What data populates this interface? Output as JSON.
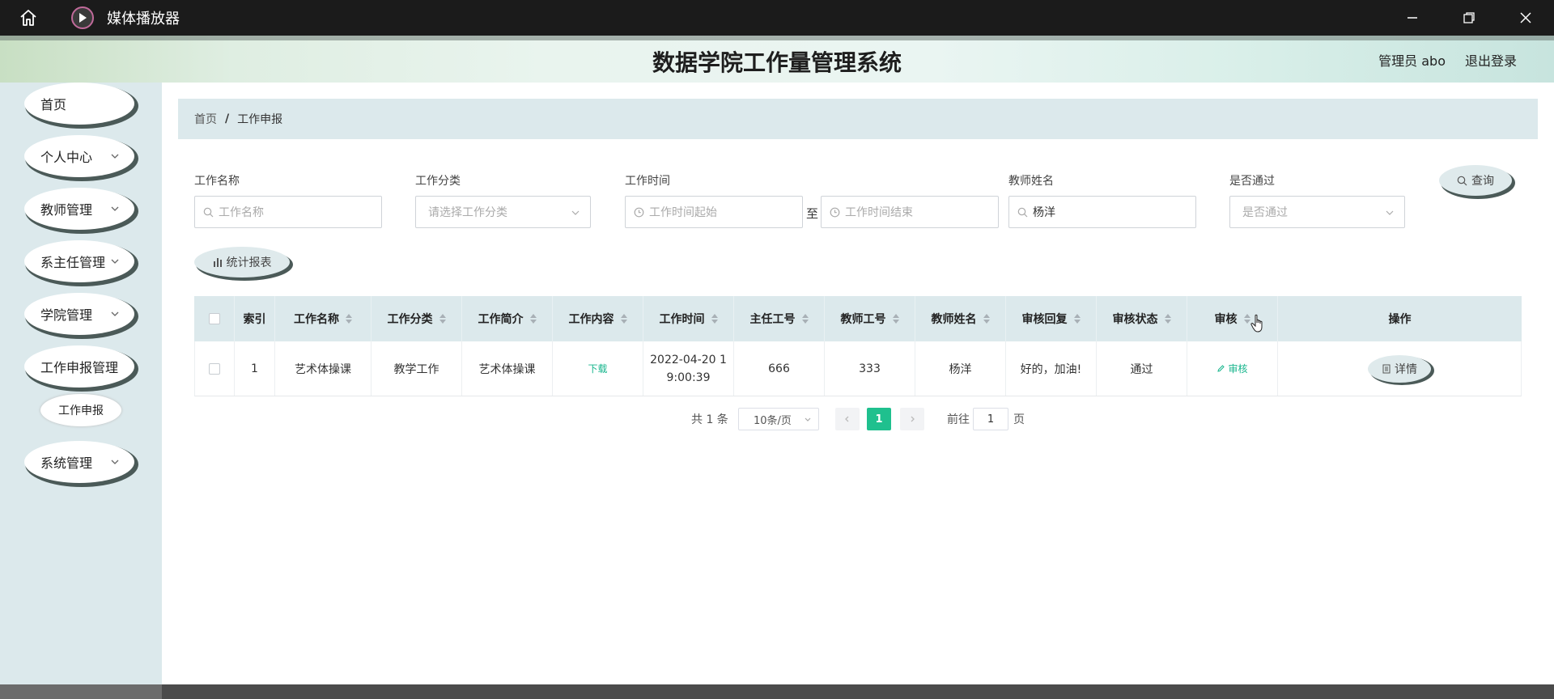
{
  "window": {
    "title": "媒体播放器"
  },
  "header": {
    "system_title": "数据学院工作量管理系统",
    "admin": "管理员 abo",
    "logout": "退出登录"
  },
  "sidebar": {
    "items": [
      {
        "label": "首页"
      },
      {
        "label": "个人中心"
      },
      {
        "label": "教师管理"
      },
      {
        "label": "系主任管理"
      },
      {
        "label": "学院管理"
      },
      {
        "label": "工作申报管理"
      },
      {
        "label": "系统管理"
      }
    ],
    "sub_item": "工作申报"
  },
  "breadcrumb": {
    "home": "首页",
    "separator": "/",
    "current": "工作申报"
  },
  "search": {
    "name_label": "工作名称",
    "name_placeholder": "工作名称",
    "category_label": "工作分类",
    "category_placeholder": "请选择工作分类",
    "time_label": "工作时间",
    "time_start_placeholder": "工作时间起始",
    "time_to": "至",
    "time_end_placeholder": "工作时间结束",
    "teacher_label": "教师姓名",
    "teacher_value": "杨洋",
    "passed_label": "是否通过",
    "passed_placeholder": "是否通过",
    "query_button": "查询",
    "report_button": "统计报表"
  },
  "table": {
    "headers": [
      "索引",
      "工作名称",
      "工作分类",
      "工作简介",
      "工作内容",
      "工作时间",
      "主任工号",
      "教师工号",
      "教师姓名",
      "审核回复",
      "审核状态",
      "审核",
      "操作"
    ],
    "rows": [
      {
        "index": "1",
        "name": "艺术体操课",
        "category": "教学工作",
        "intro": "艺术体操课",
        "content_link": "下载",
        "time_line1": "2022-04-20 1",
        "time_line2": "9:00:39",
        "director_id": "666",
        "teacher_id": "333",
        "teacher_name": "杨洋",
        "reply": "好的，加油!",
        "status": "通过",
        "audit_link": "审核",
        "detail_button": "详情"
      }
    ]
  },
  "pagination": {
    "total": "共 1 条",
    "page_size": "10条/页",
    "current_page": "1",
    "goto_prefix": "前往",
    "goto_value": "1",
    "goto_suffix": "页"
  },
  "colors": {
    "accent": "#1fc08e",
    "sidebar_bg": "#dce9ec",
    "titlebar_bg": "#1b1b1b"
  }
}
